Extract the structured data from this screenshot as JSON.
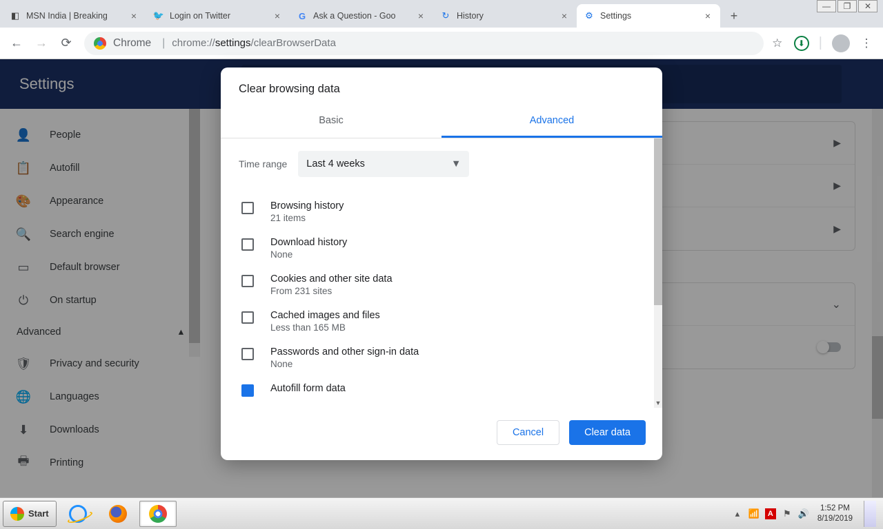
{
  "window_controls": {
    "min": "—",
    "max": "❐",
    "close": "✕"
  },
  "tabs": [
    {
      "title": "MSN India | Breaking",
      "fav": "◧"
    },
    {
      "title": "Login on Twitter",
      "fav": "🐦"
    },
    {
      "title": "Ask a Question - Goo",
      "fav": "G"
    },
    {
      "title": "History",
      "fav": "↻"
    },
    {
      "title": "Settings",
      "fav": "⚙"
    }
  ],
  "active_tab_index": 4,
  "omnibox": {
    "chrome_label": "Chrome",
    "sep": "|",
    "url_pre": "chrome://",
    "url_bold": "settings",
    "url_rest": "/clearBrowserData"
  },
  "toolbar_icons": {
    "star": "☆",
    "dl": "⬇",
    "menu": "⋮"
  },
  "settings_header": "Settings",
  "sidebar": {
    "items": [
      {
        "icon": "👤",
        "label": "People"
      },
      {
        "icon": "📋",
        "label": "Autofill"
      },
      {
        "icon": "🎨",
        "label": "Appearance"
      },
      {
        "icon": "🔍",
        "label": "Search engine"
      },
      {
        "icon": "▭",
        "label": "Default browser"
      },
      {
        "icon": "⏻",
        "label": "On startup"
      }
    ],
    "section": {
      "label": "Advanced",
      "chev": "▴"
    },
    "adv_items": [
      {
        "icon": "🛡",
        "label": "Privacy and security"
      },
      {
        "icon": "🌐",
        "label": "Languages"
      },
      {
        "icon": "⬇",
        "label": "Downloads"
      },
      {
        "icon": "🖶",
        "label": "Printing"
      }
    ]
  },
  "dialog": {
    "title": "Clear browsing data",
    "tabs": {
      "basic": "Basic",
      "advanced": "Advanced"
    },
    "time_label": "Time range",
    "time_value": "Last 4 weeks",
    "items": [
      {
        "checked": false,
        "title": "Browsing history",
        "sub": "21 items"
      },
      {
        "checked": false,
        "title": "Download history",
        "sub": "None"
      },
      {
        "checked": false,
        "title": "Cookies and other site data",
        "sub": "From 231 sites"
      },
      {
        "checked": false,
        "title": "Cached images and files",
        "sub": "Less than 165 MB"
      },
      {
        "checked": false,
        "title": "Passwords and other sign-in data",
        "sub": "None"
      },
      {
        "checked": true,
        "title": "Autofill form data",
        "sub": ""
      }
    ],
    "cancel": "Cancel",
    "confirm": "Clear data"
  },
  "taskbar": {
    "start": "Start",
    "tray": {
      "up": "▴",
      "wifi": "📶",
      "av": "A",
      "flag": "⚑",
      "vol": "🔊"
    },
    "time": "1:52 PM",
    "date": "8/19/2019"
  }
}
